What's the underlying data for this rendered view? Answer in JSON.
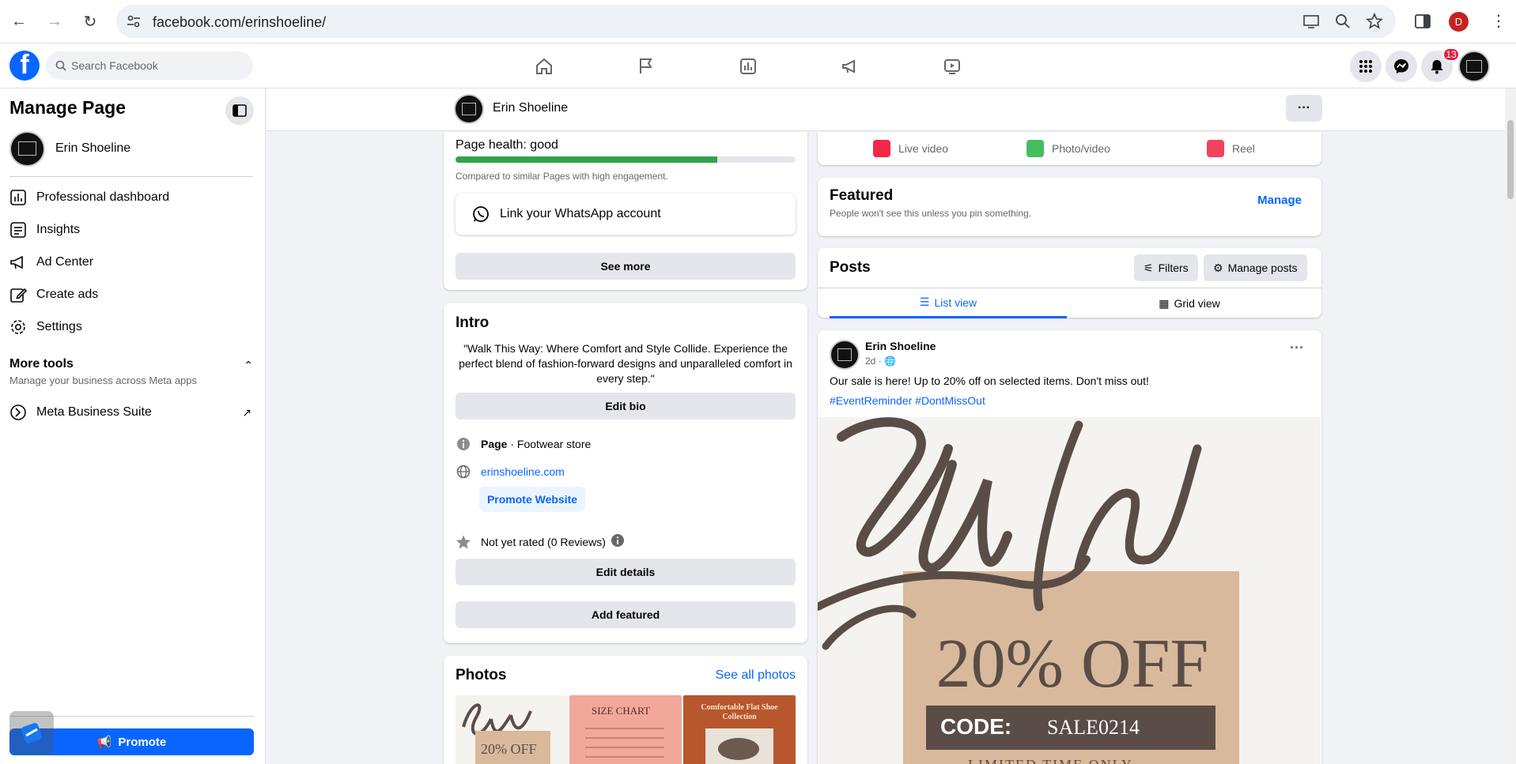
{
  "browser": {
    "url": "facebook.com/erinshoeline/",
    "profile_initial": "D"
  },
  "fb": {
    "logo": "f",
    "search_placeholder": "Search Facebook",
    "notification_count": "13"
  },
  "sidebar": {
    "title": "Manage Page",
    "page_name": "Erin Shoeline",
    "items": [
      {
        "label": "Professional dashboard",
        "icon": "dashboard-icon"
      },
      {
        "label": "Insights",
        "icon": "insights-icon"
      },
      {
        "label": "Ad Center",
        "icon": "megaphone-icon"
      },
      {
        "label": "Create ads",
        "icon": "edit-icon"
      },
      {
        "label": "Settings",
        "icon": "gear-icon"
      }
    ],
    "more_tools_title": "More tools",
    "more_tools_subtitle": "Manage your business across Meta apps",
    "meta_suite": "Meta Business Suite",
    "promote": "Promote"
  },
  "page_header": {
    "name": "Erin Shoeline",
    "more": "···"
  },
  "health": {
    "label": "Page health: good",
    "fill_fraction": 0.77,
    "compare": "Compared to similar Pages with high engagement.",
    "whatsapp": "Link your WhatsApp account",
    "see_more": "See more"
  },
  "intro": {
    "title": "Intro",
    "bio": "\"Walk This Way: Where Comfort and Style Collide. Experience the perfect blend of fashion-forward designs and unparalleled comfort in every step.\"",
    "edit_bio": "Edit bio",
    "category_bold": "Page",
    "category_rest": " · Footwear store",
    "website": "erinshoeline.com",
    "promote_website": "Promote Website",
    "rating": "Not yet rated (0 Reviews)",
    "edit_details": "Edit details",
    "add_featured": "Add featured"
  },
  "photos": {
    "title": "Photos",
    "see_all": "See all photos",
    "thumb1_text": "20% OFF",
    "thumb2_title": "SIZE CHART",
    "thumb3_title": "Comfortable Flat Shoe Collection"
  },
  "create": {
    "live": "Live video",
    "photo": "Photo/video",
    "reel": "Reel"
  },
  "featured": {
    "title": "Featured",
    "subtitle": "People won't see this unless you pin something.",
    "manage": "Manage"
  },
  "posts": {
    "title": "Posts",
    "filters": "Filters",
    "manage_posts": "Manage posts",
    "list_view": "List view",
    "grid_view": "Grid view"
  },
  "post": {
    "author": "Erin Shoeline",
    "time": "2d ·",
    "text": "Our sale is here! Up to 20% off on selected items. Don't miss out!",
    "tags": "#EventReminder #DontMissOut",
    "image_script": "Sale",
    "image_offer": "20% OFF",
    "code_label": "CODE:",
    "code_value": "SALE0214",
    "bottom_text": "LIMITED TIME ONLY"
  }
}
